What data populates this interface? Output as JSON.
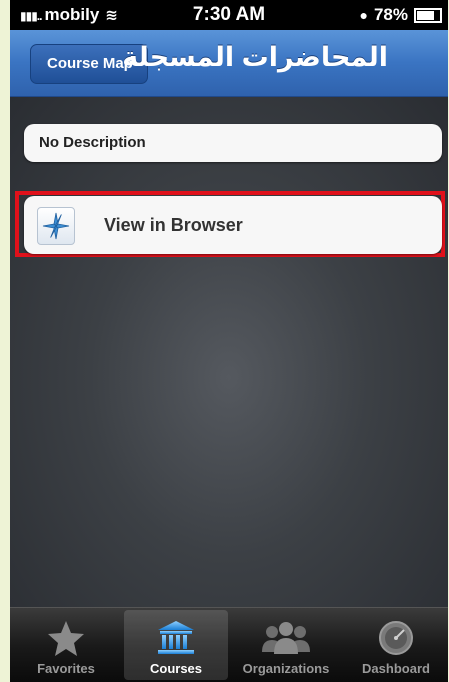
{
  "status": {
    "carrier": "mobily",
    "time": "7:30 AM",
    "battery": "78%"
  },
  "navbar": {
    "back_label": "Course Map",
    "title": "المحاضرات المسجلة"
  },
  "content": {
    "description": "No Description",
    "browser_label": "View in Browser"
  },
  "tabs": [
    {
      "label": "Favorites",
      "icon": "star-icon"
    },
    {
      "label": "Courses",
      "icon": "courses-building-icon"
    },
    {
      "label": "Organizations",
      "icon": "people-icon"
    },
    {
      "label": "Dashboard",
      "icon": "gauge-icon"
    }
  ],
  "colors": {
    "nav_blue": "#3a74c2",
    "highlight_red": "#e0111b"
  }
}
